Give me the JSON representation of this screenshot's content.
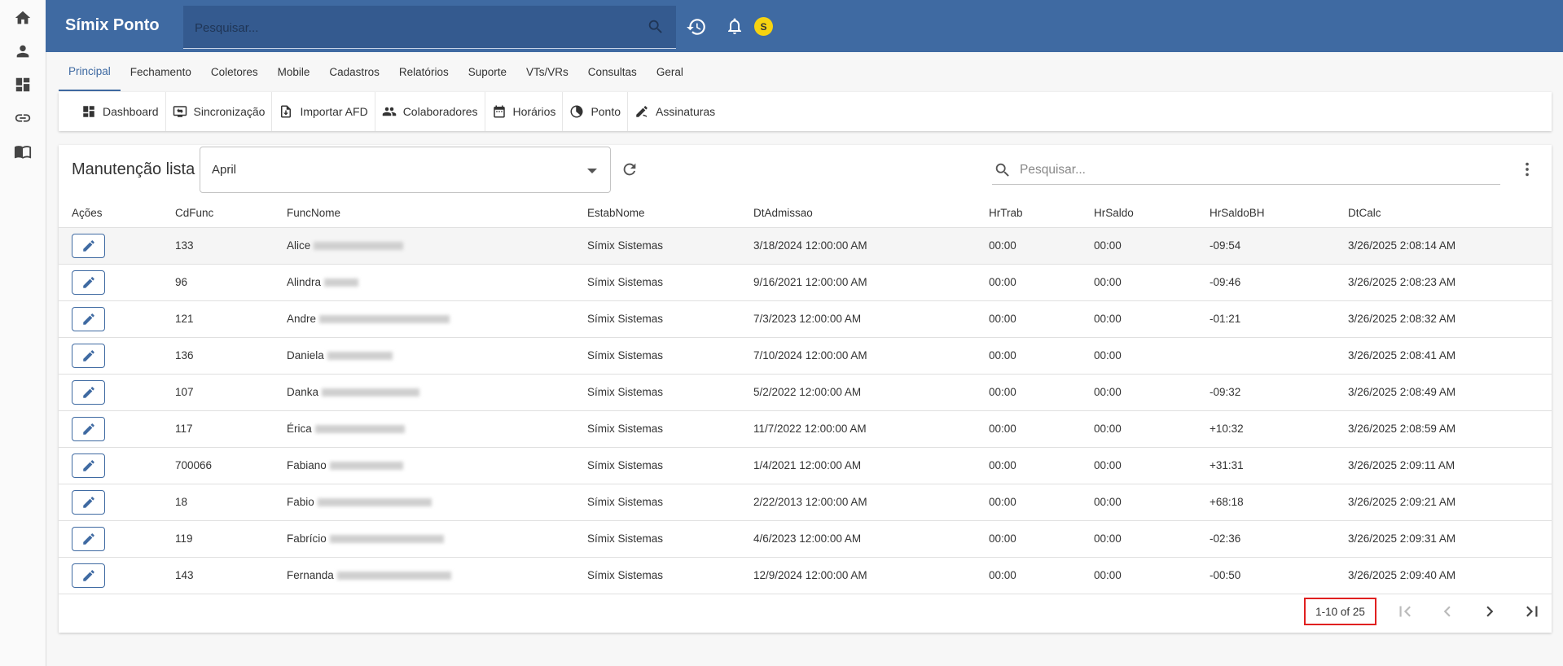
{
  "app": {
    "title": "Símix Ponto",
    "avatar_initial": "S"
  },
  "top_search": {
    "placeholder": "Pesquisar..."
  },
  "rail": [
    "home-icon",
    "person-icon",
    "dashboard-icon",
    "link-icon",
    "book-icon"
  ],
  "tabs": [
    {
      "label": "Principal",
      "active": true
    },
    {
      "label": "Fechamento"
    },
    {
      "label": "Coletores"
    },
    {
      "label": "Mobile"
    },
    {
      "label": "Cadastros"
    },
    {
      "label": "Relatórios"
    },
    {
      "label": "Suporte"
    },
    {
      "label": "VTs/VRs"
    },
    {
      "label": "Consultas"
    },
    {
      "label": "Geral"
    }
  ],
  "toolbar": [
    {
      "label": "Dashboard",
      "icon": "dashboard-icon"
    },
    {
      "label": "Sincronização",
      "icon": "sync-icon"
    },
    {
      "label": "Importar AFD",
      "icon": "import-icon"
    },
    {
      "label": "Colaboradores",
      "icon": "people-icon"
    },
    {
      "label": "Horários",
      "icon": "calendar-icon"
    },
    {
      "label": "Ponto",
      "icon": "clock-pie-icon"
    },
    {
      "label": "Assinaturas",
      "icon": "signature-icon"
    }
  ],
  "card": {
    "title": "Manutenção lista",
    "month": "April",
    "search_placeholder": "Pesquisar..."
  },
  "table": {
    "columns": [
      "Ações",
      "CdFunc",
      "FuncNome",
      "EstabNome",
      "DtAdmissao",
      "HrTrab",
      "HrSaldo",
      "HrSaldoBH",
      "DtCalc"
    ],
    "rows": [
      {
        "cd": "133",
        "nome": "Alice",
        "estab": "Símix Sistemas",
        "adm": "3/18/2024 12:00:00 AM",
        "trab": "00:00",
        "saldo": "00:00",
        "bh": "-09:54",
        "calc": "3/26/2025 2:08:14 AM"
      },
      {
        "cd": "96",
        "nome": "Alindra",
        "estab": "Símix Sistemas",
        "adm": "9/16/2021 12:00:00 AM",
        "trab": "00:00",
        "saldo": "00:00",
        "bh": "-09:46",
        "calc": "3/26/2025 2:08:23 AM"
      },
      {
        "cd": "121",
        "nome": "Andre",
        "estab": "Símix Sistemas",
        "adm": "7/3/2023 12:00:00 AM",
        "trab": "00:00",
        "saldo": "00:00",
        "bh": "-01:21",
        "calc": "3/26/2025 2:08:32 AM"
      },
      {
        "cd": "136",
        "nome": "Daniela",
        "estab": "Símix Sistemas",
        "adm": "7/10/2024 12:00:00 AM",
        "trab": "00:00",
        "saldo": "00:00",
        "bh": "",
        "calc": "3/26/2025 2:08:41 AM"
      },
      {
        "cd": "107",
        "nome": "Danka",
        "estab": "Símix Sistemas",
        "adm": "5/2/2022 12:00:00 AM",
        "trab": "00:00",
        "saldo": "00:00",
        "bh": "-09:32",
        "calc": "3/26/2025 2:08:49 AM"
      },
      {
        "cd": "117",
        "nome": "Érica",
        "estab": "Símix Sistemas",
        "adm": "11/7/2022 12:00:00 AM",
        "trab": "00:00",
        "saldo": "00:00",
        "bh": "+10:32",
        "calc": "3/26/2025 2:08:59 AM"
      },
      {
        "cd": "700066",
        "nome": "Fabiano",
        "estab": "Símix Sistemas",
        "adm": "1/4/2021 12:00:00 AM",
        "trab": "00:00",
        "saldo": "00:00",
        "bh": "+31:31",
        "calc": "3/26/2025 2:09:11 AM"
      },
      {
        "cd": "18",
        "nome": "Fabio",
        "estab": "Símix Sistemas",
        "adm": "2/22/2013 12:00:00 AM",
        "trab": "00:00",
        "saldo": "00:00",
        "bh": "+68:18",
        "calc": "3/26/2025 2:09:21 AM"
      },
      {
        "cd": "119",
        "nome": "Fabrício",
        "estab": "Símix Sistemas",
        "adm": "4/6/2023 12:00:00 AM",
        "trab": "00:00",
        "saldo": "00:00",
        "bh": "-02:36",
        "calc": "3/26/2025 2:09:31 AM"
      },
      {
        "cd": "143",
        "nome": "Fernanda",
        "estab": "Símix Sistemas",
        "adm": "12/9/2024 12:00:00 AM",
        "trab": "00:00",
        "saldo": "00:00",
        "bh": "-00:50",
        "calc": "3/26/2025 2:09:40 AM"
      }
    ]
  },
  "pagination": {
    "range": "1-10 of 25"
  },
  "colors": {
    "primary": "#3f6aa2",
    "avatar": "#f6d311",
    "highlight_border": "#e02020"
  }
}
